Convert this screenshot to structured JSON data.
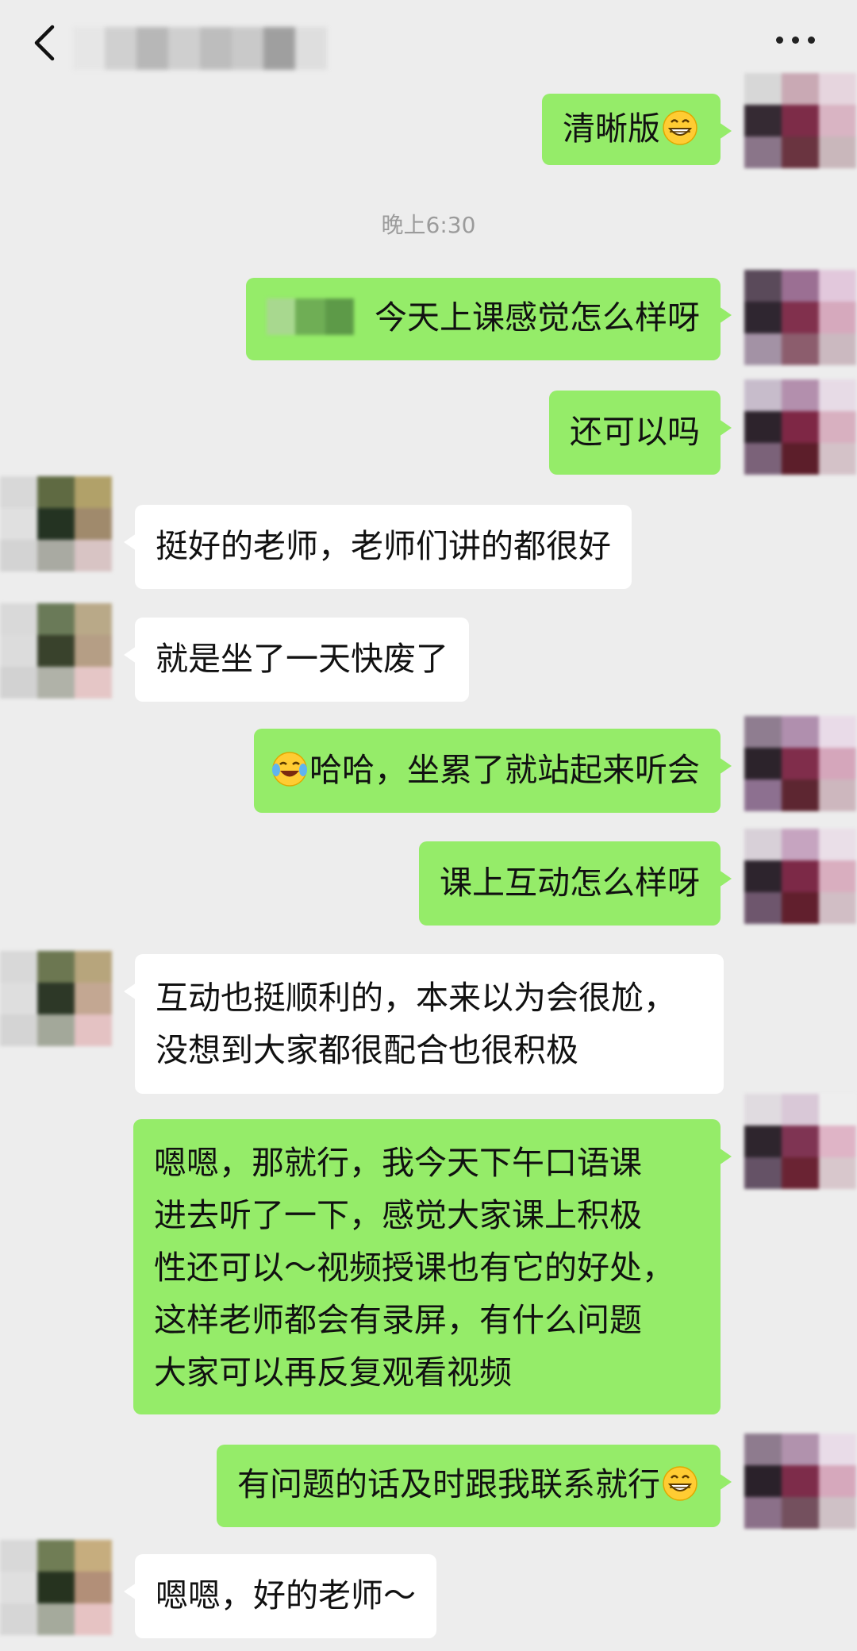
{
  "header": {
    "back_label": "",
    "more_label": "···"
  },
  "chat": {
    "time_divider": "晚上6:30",
    "messages": [
      {
        "side": "out",
        "text": "清晰版",
        "emoji_after": "grin-emoji"
      },
      {
        "side": "out",
        "text": "今天上课感觉怎么样呀",
        "prefix": "blurred-name"
      },
      {
        "side": "out",
        "text": "还可以吗"
      },
      {
        "side": "in",
        "text": "挺好的老师，老师们讲的都很好"
      },
      {
        "side": "in",
        "text": "就是坐了一天快废了"
      },
      {
        "side": "out",
        "text": "哈哈，坐累了就站起来听会",
        "emoji_before": "laugh-cry-emoji"
      },
      {
        "side": "out",
        "text": "课上互动怎么样呀"
      },
      {
        "side": "in",
        "lines": [
          "互动也挺顺利的，本来以为会很尬，",
          "没想到大家都很配合也很积极"
        ]
      },
      {
        "side": "out",
        "lines": [
          "嗯嗯，那就行，我今天下午口语课",
          "进去听了一下，感觉大家课上积极",
          "性还可以～视频授课也有它的好处，",
          "这样老师都会有录屏，有什么问题",
          "大家可以再反复观看视频"
        ]
      },
      {
        "side": "out",
        "text": "有问题的话及时跟我联系就行",
        "emoji_after": "grin-emoji"
      },
      {
        "side": "in",
        "text": "嗯嗯，好的老师～"
      }
    ]
  },
  "colors": {
    "background": "#ededed",
    "outgoing_bubble": "#95ec69",
    "incoming_bubble": "#ffffff",
    "time_text": "#9b9b9b"
  }
}
